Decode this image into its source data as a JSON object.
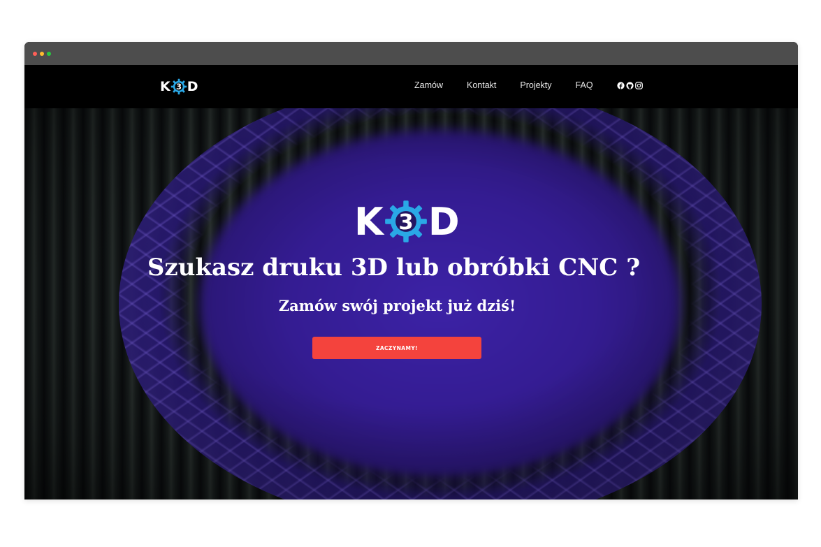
{
  "brand": {
    "logo_left": "K",
    "logo_center": "3",
    "logo_right": "D",
    "gear_color": "#2aa8e6"
  },
  "nav": {
    "items": [
      {
        "label": "Zamów"
      },
      {
        "label": "Kontakt"
      },
      {
        "label": "Projekty"
      },
      {
        "label": "FAQ"
      }
    ],
    "social_icons": [
      "facebook-icon",
      "github-icon",
      "instagram-icon"
    ]
  },
  "hero": {
    "title": "Szukasz druku 3D lub obróbki CNC ?",
    "subtitle": "Zamów swój projekt już dziś!",
    "cta_label": "ZACZYNAMY!",
    "cta_color": "#f4433d",
    "accent_purple": "#3c22a6"
  }
}
